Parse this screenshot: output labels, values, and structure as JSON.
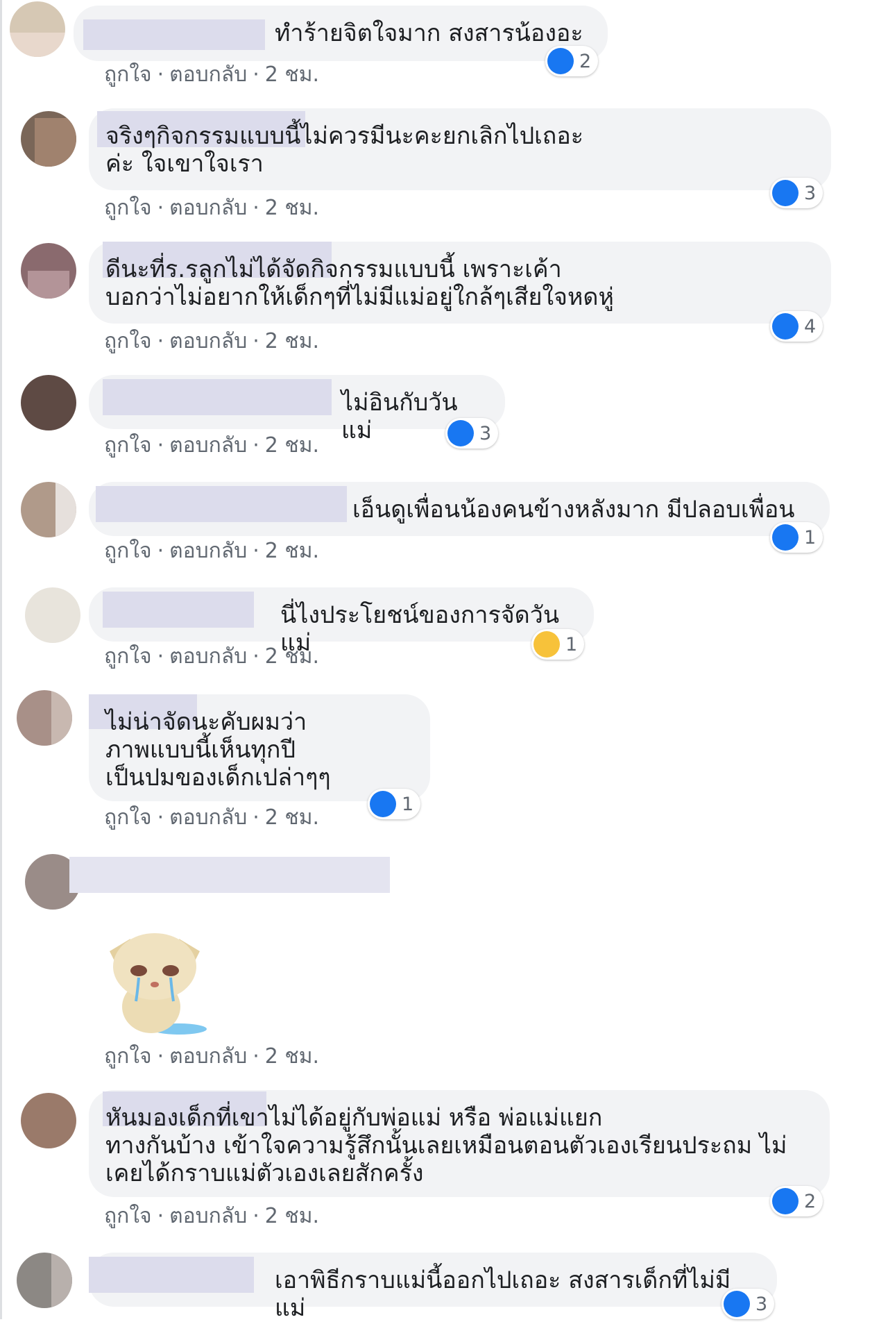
{
  "comments": [
    {
      "text": "ทำร้ายจิตใจมาก สงสารน้องอะ",
      "reaction_count": "2"
    },
    {
      "text": "จริงๆกิจกรรมแบบนี้ไม่ควรมีนะคะยกเลิกไปเถอะ\nค่ะ ใจเขาใจเรา",
      "reaction_count": "3"
    },
    {
      "text": "ดีนะที่ร.รลูกไม่ได้จัดกิจกรรมแบบนี้ เพราะเค้า\nบอกว่าไม่อยากให้เด็กๆที่ไม่มีแม่อยู่ใกล้ๆเสียใจหดหู่",
      "reaction_count": "4"
    },
    {
      "text": "ไม่อินกับวันแม่",
      "reaction_count": "3"
    },
    {
      "text": "เอ็นดูเพื่อนน้องคนข้างหลังมาก มีปลอบเพื่อน",
      "reaction_count": "1"
    },
    {
      "text": "นี่ไงประโยชน์ของการจัดวันแม่",
      "reaction_count": "1"
    },
    {
      "text": "ไม่น่าจัดนะคับผมว่า\nภาพแบบนี้เห็นทุกปี\nเป็นปมของเด็กเปล่าๆๆ",
      "reaction_count": "1"
    },
    {
      "text": "",
      "reaction_count": ""
    },
    {
      "text": "หันมองเด็กที่เขาไม่ได้อยู่กับพ่อแม่ หรือ พ่อแม่แยก\nทางกันบ้าง เข้าใจความรู้สึกนั้นเลยเหมือนตอนตัวเองเรียนประถม ไม่\nเคยได้กราบแม่ตัวเองเลยสักครั้ง",
      "reaction_count": "2"
    },
    {
      "text": "เอาพิธีกราบแม่นี้ออกไปเถอะ สงสารเด็กที่ไม่มีแม่",
      "reaction_count": "3"
    }
  ],
  "actions": {
    "like": "ถูกใจ",
    "reply": "ตอบกลับ",
    "dot": "·",
    "time": "2 ชม."
  },
  "colors": {
    "bubble": "#f2f3f5",
    "like_blue": "#1877f2",
    "meta_gray": "#606770",
    "sad_yellow": "#f7c23a"
  }
}
